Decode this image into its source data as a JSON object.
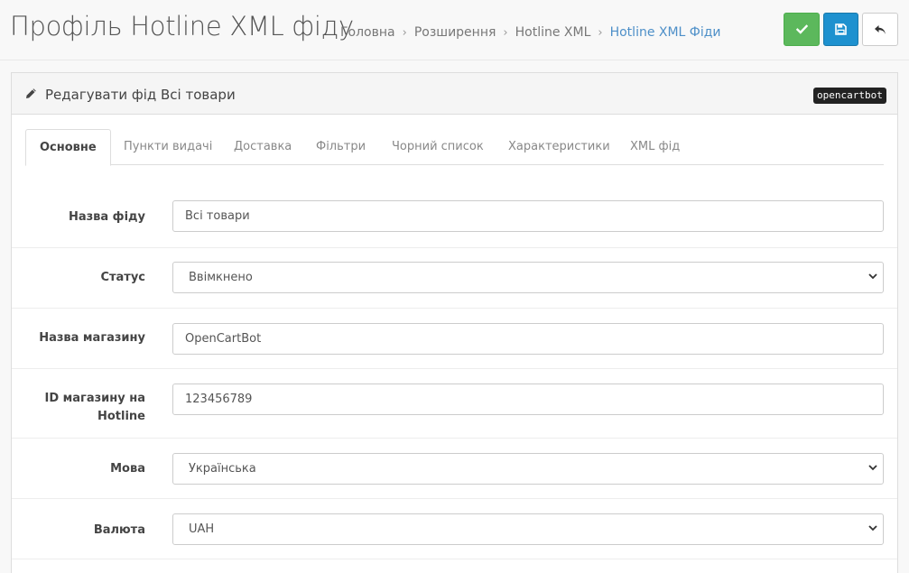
{
  "header": {
    "title": "Профіль Hotline XML фіду",
    "breadcrumb": [
      "Головна",
      "Розширення",
      "Hotline XML",
      "Hotline XML Фіди"
    ],
    "separator": "›"
  },
  "actions": {
    "confirm_icon": "check-icon",
    "save_icon": "floppy-icon",
    "back_icon": "reply-icon",
    "colors": {
      "confirm": "#5cb85c",
      "save": "#1e91cf",
      "back": "#ffffff"
    }
  },
  "panel": {
    "title": "Редагувати фід Всі товари",
    "badge": "opencartbot"
  },
  "tabs": [
    "Основне",
    "Пункти видачі",
    "Доставка",
    "Фільтри",
    "Чорний список",
    "Характеристики",
    "XML фід"
  ],
  "form": {
    "feed_name": {
      "label": "Назва фіду",
      "value": "Всі товари"
    },
    "status": {
      "label": "Статус",
      "value": "Ввімкнено"
    },
    "shop_name": {
      "label": "Назва магазину",
      "value": "OpenCartBot"
    },
    "shop_id": {
      "label_line1": "ID магазину на",
      "label_line2": "Hotline",
      "value": "123456789"
    },
    "language": {
      "label": "Мова",
      "value": "Українська"
    },
    "currency": {
      "label": "Валюта",
      "value": "UAH"
    }
  }
}
